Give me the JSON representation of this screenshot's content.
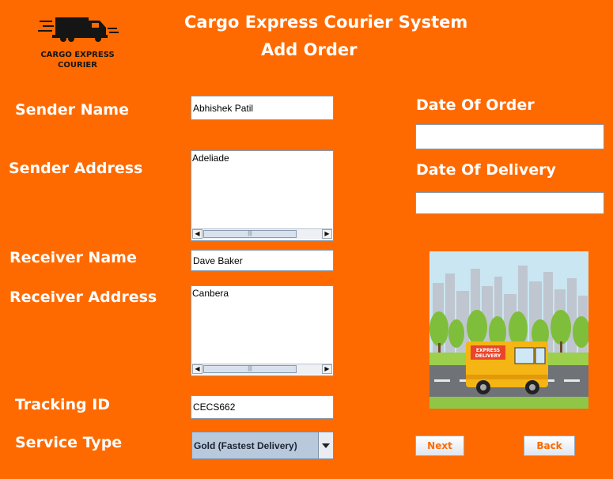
{
  "header": {
    "title": "Cargo Express Courier System",
    "subtitle": "Add Order"
  },
  "logo": {
    "line1": "CARGO EXPRESS",
    "line2": "COURIER"
  },
  "form": {
    "sender_name_label": "Sender Name",
    "sender_name_value": "Abhishek Patil",
    "sender_address_label": "Sender Address",
    "sender_address_value": "Adeliade",
    "receiver_name_label": "Receiver Name",
    "receiver_name_value": "Dave Baker",
    "receiver_address_label": "Receiver Address",
    "receiver_address_value": "Canbera",
    "tracking_id_label": "Tracking ID",
    "tracking_id_value": "CECS662",
    "service_type_label": "Service Type",
    "service_type_value": "Gold (Fastest Delivery)",
    "date_of_order_label": "Date Of Order",
    "date_of_order_value": "",
    "date_of_delivery_label": "Date Of Delivery",
    "date_of_delivery_value": ""
  },
  "illustration": {
    "van_text_line1": "EXPRESS",
    "van_text_line2": "DELIVERY"
  },
  "buttons": {
    "next": "Next",
    "back": "Back"
  },
  "colors": {
    "background": "#ff6a00",
    "text": "#ffffff",
    "button_text": "#ff6a00"
  }
}
